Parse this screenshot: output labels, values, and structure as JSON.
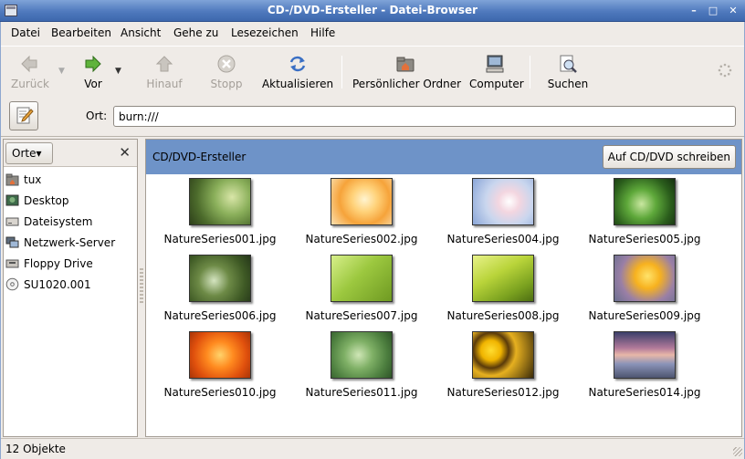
{
  "window": {
    "title": "CD-/DVD-Ersteller - Datei-Browser"
  },
  "menu": {
    "items": [
      "Datei",
      "Bearbeiten",
      "Ansicht",
      "Gehe zu",
      "Lesezeichen",
      "Hilfe"
    ]
  },
  "toolbar": {
    "back_label": "Zurück",
    "forward_label": "Vor",
    "up_label": "Hinauf",
    "stop_label": "Stopp",
    "reload_label": "Aktualisieren",
    "home_label": "Persönlicher Ordner",
    "computer_label": "Computer",
    "search_label": "Suchen"
  },
  "location": {
    "label": "Ort:",
    "value": "burn:///"
  },
  "sidebar": {
    "selector_label": "Orte",
    "items": [
      "tux",
      "Desktop",
      "Dateisystem",
      "Netzwerk-Server",
      "Floppy Drive",
      "SU1020.001"
    ]
  },
  "content": {
    "title": "CD/DVD-Ersteller",
    "burn_button": "Auf CD/DVD schreiben",
    "files": [
      "NatureSeries001.jpg",
      "NatureSeries002.jpg",
      "NatureSeries004.jpg",
      "NatureSeries005.jpg",
      "NatureSeries006.jpg",
      "NatureSeries007.jpg",
      "NatureSeries008.jpg",
      "NatureSeries009.jpg",
      "NatureSeries010.jpg",
      "NatureSeries011.jpg",
      "NatureSeries012.jpg",
      "NatureSeries014.jpg"
    ]
  },
  "status": {
    "text": "12 Objekte"
  }
}
